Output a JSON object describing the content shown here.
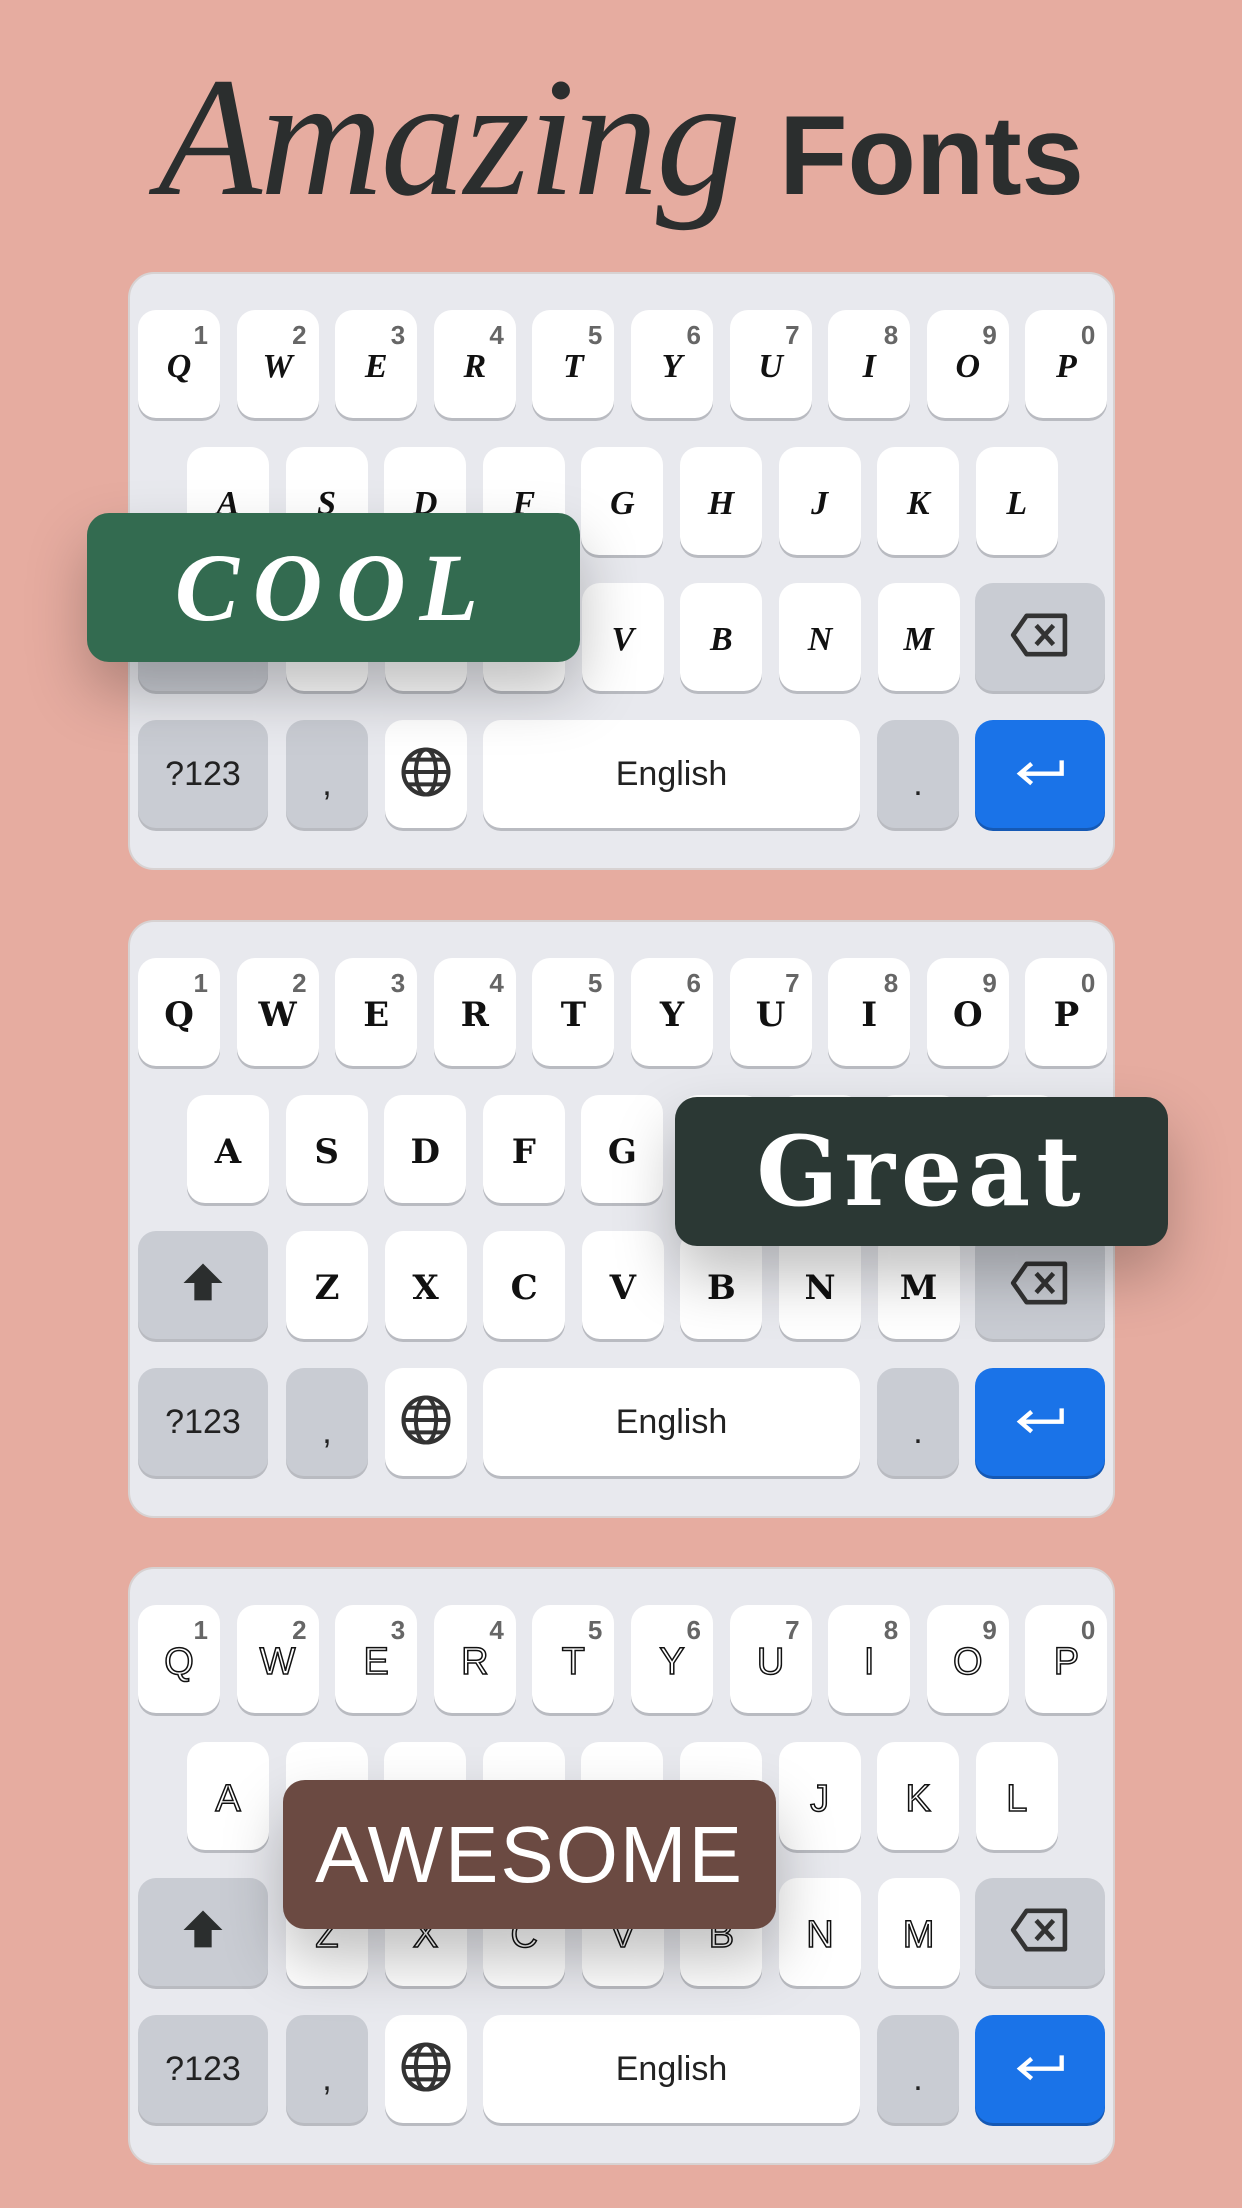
{
  "title": {
    "script_word": "Amazing",
    "bold_word": "Fonts"
  },
  "colors": {
    "background": "#e6aca0",
    "keyboard_bg": "#e8e9ee",
    "special_key": "#c9ccd3",
    "enter_key": "#1a73e8"
  },
  "keyboards": [
    {
      "style": "script",
      "badge": {
        "label": "COOL",
        "color": "#336b50"
      }
    },
    {
      "style": "gothic",
      "badge": {
        "label": "Great",
        "color": "#2b3834"
      }
    },
    {
      "style": "outline",
      "badge": {
        "label": "AWESOME",
        "color": "#6b4a42"
      }
    }
  ],
  "rows": {
    "row1": [
      "Q",
      "W",
      "E",
      "R",
      "T",
      "Y",
      "U",
      "I",
      "O",
      "P"
    ],
    "row1_numbers": [
      "1",
      "2",
      "3",
      "4",
      "5",
      "6",
      "7",
      "8",
      "9",
      "0"
    ],
    "row2": [
      "A",
      "S",
      "D",
      "F",
      "G",
      "H",
      "J",
      "K",
      "L"
    ],
    "row3": [
      "Z",
      "X",
      "C",
      "V",
      "B",
      "N",
      "M"
    ]
  },
  "bottom_row": {
    "symbols_label": "?123",
    "comma": ",",
    "space_label": "English",
    "period": "."
  },
  "icons": {
    "shift": "shift-arrow-icon",
    "backspace": "backspace-icon",
    "globe": "globe-icon",
    "enter": "enter-arrow-icon"
  }
}
